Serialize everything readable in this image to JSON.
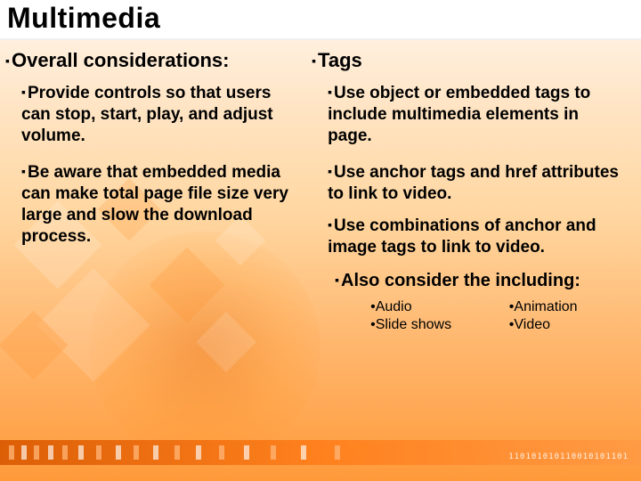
{
  "title": "Multimedia",
  "left": {
    "heading": "Overall considerations:",
    "items": [
      "Provide controls so that users can stop, start, play, and adjust volume.",
      "Be aware that embedded media can make total page file size very large and slow the download process."
    ]
  },
  "right": {
    "heading": "Tags",
    "items": [
      "Use object or embedded tags to include multimedia elements in page.",
      "Use anchor tags and href attributes to link to video.",
      "Use combinations of anchor and image tags to link to video."
    ],
    "also_heading": "Also consider the including:",
    "small_items": [
      "Audio",
      "Animation",
      "Slide shows",
      "Video"
    ]
  },
  "decor_digits": "110101010110010101101"
}
